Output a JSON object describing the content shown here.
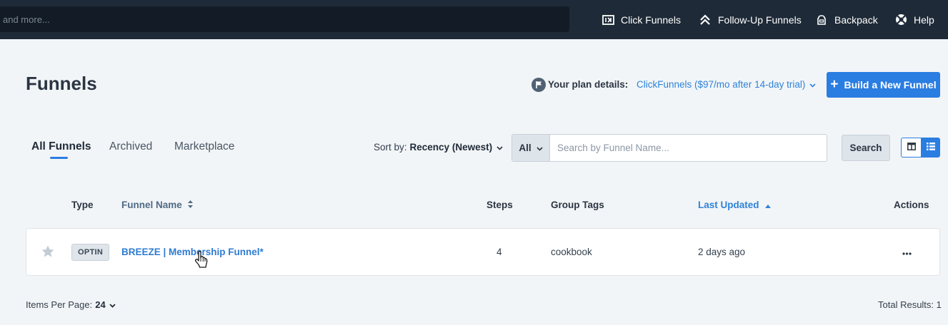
{
  "topnav": {
    "search_placeholder": "and more...",
    "items": [
      {
        "label": "Click Funnels",
        "icon": "clickfunnels-logo-icon"
      },
      {
        "label": "Follow-Up Funnels",
        "icon": "double-chevron-up-icon"
      },
      {
        "label": "Backpack",
        "icon": "backpack-icon"
      },
      {
        "label": "Help",
        "icon": "help-lifebuoy-icon"
      }
    ]
  },
  "header": {
    "title": "Funnels",
    "plan_label": "Your plan details:",
    "plan_value": "ClickFunnels ($97/mo after 14-day trial)",
    "build_button": "Build a New Funnel"
  },
  "tabs": [
    {
      "label": "All Funnels",
      "active": true
    },
    {
      "label": "Archived",
      "active": false
    },
    {
      "label": "Marketplace",
      "active": false
    }
  ],
  "sort": {
    "label": "Sort by:",
    "value": "Recency (Newest)"
  },
  "search": {
    "filter_value": "All",
    "placeholder": "Search by Funnel Name...",
    "button_label": "Search"
  },
  "view_toggle": {
    "selected": "list"
  },
  "table": {
    "headers": {
      "type": "Type",
      "name": "Funnel Name",
      "steps": "Steps",
      "tags": "Group Tags",
      "updated": "Last Updated",
      "actions": "Actions"
    },
    "rows": [
      {
        "starred": false,
        "type": "OPTIN",
        "name": "BREEZE | Membership Funnel*",
        "steps": "4",
        "tags": "cookbook",
        "updated": "2 days ago",
        "actions": "•••"
      }
    ]
  },
  "footer": {
    "per_page_label": "Items Per Page:",
    "per_page_value": "24",
    "total": "Total Results: 1"
  },
  "colors": {
    "accent": "#2a7de1",
    "nav_bg": "#1e2a37",
    "page_bg": "#f2f5f7"
  }
}
